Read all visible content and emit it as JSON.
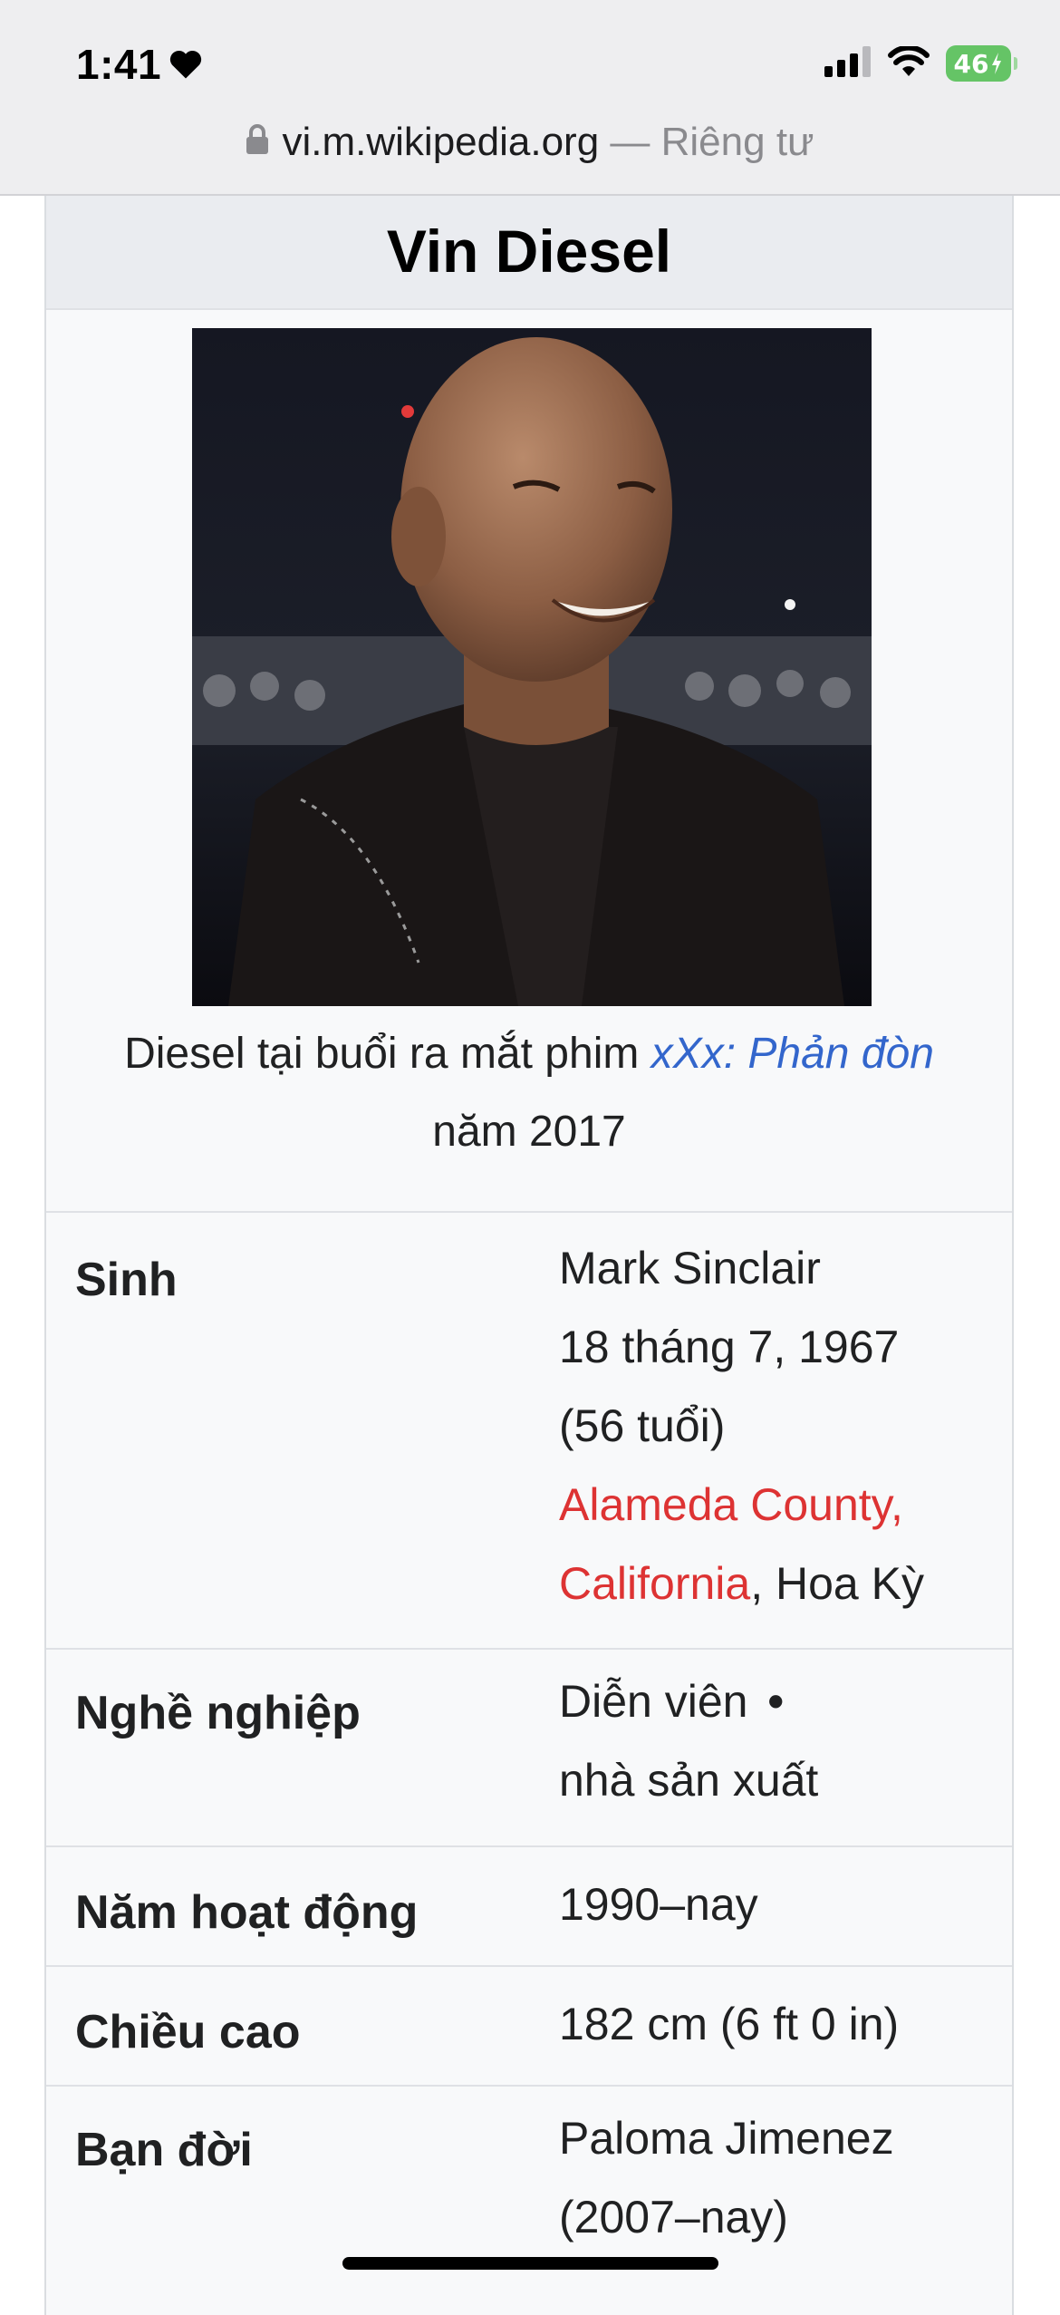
{
  "status_bar": {
    "time": "1:41",
    "battery": "46"
  },
  "url_bar": {
    "host": "vi.m.wikipedia.org",
    "suffix": "— Riêng tư"
  },
  "infobox": {
    "title": "Vin Diesel",
    "caption": {
      "prefix": "Diesel tại buổi ra mắt phim ",
      "film_link": "xXx: Phản đòn",
      "suffix": " năm 2017"
    },
    "rows": {
      "born": {
        "label": "Sinh",
        "name": "Mark Sinclair",
        "date": "18 tháng 7, 1967",
        "age": "(56 tuổi)",
        "place_link": "Alameda County, California",
        "country": ", Hoa Kỳ"
      },
      "occupation": {
        "label": "Nghề nghiệp",
        "item1": "Diễn viên",
        "bullet": "•",
        "item2": "nhà sản xuất"
      },
      "years_active": {
        "label": "Năm hoạt động",
        "value": "1990–nay"
      },
      "height": {
        "label": "Chiều cao",
        "value": "182 cm (6 ft 0 in)"
      },
      "spouse": {
        "label": "Bạn đời",
        "name": "Paloma Jimenez",
        "years": "(2007–nay)"
      }
    }
  },
  "icons": {
    "status": [
      "heart-icon",
      "cellular-signal-icon",
      "wifi-icon",
      "battery-charging-icon"
    ],
    "url": [
      "lock-icon"
    ]
  },
  "colors": {
    "link_blue": "#3366cc",
    "link_red": "#dd3333",
    "battery_green": "#65c466"
  }
}
